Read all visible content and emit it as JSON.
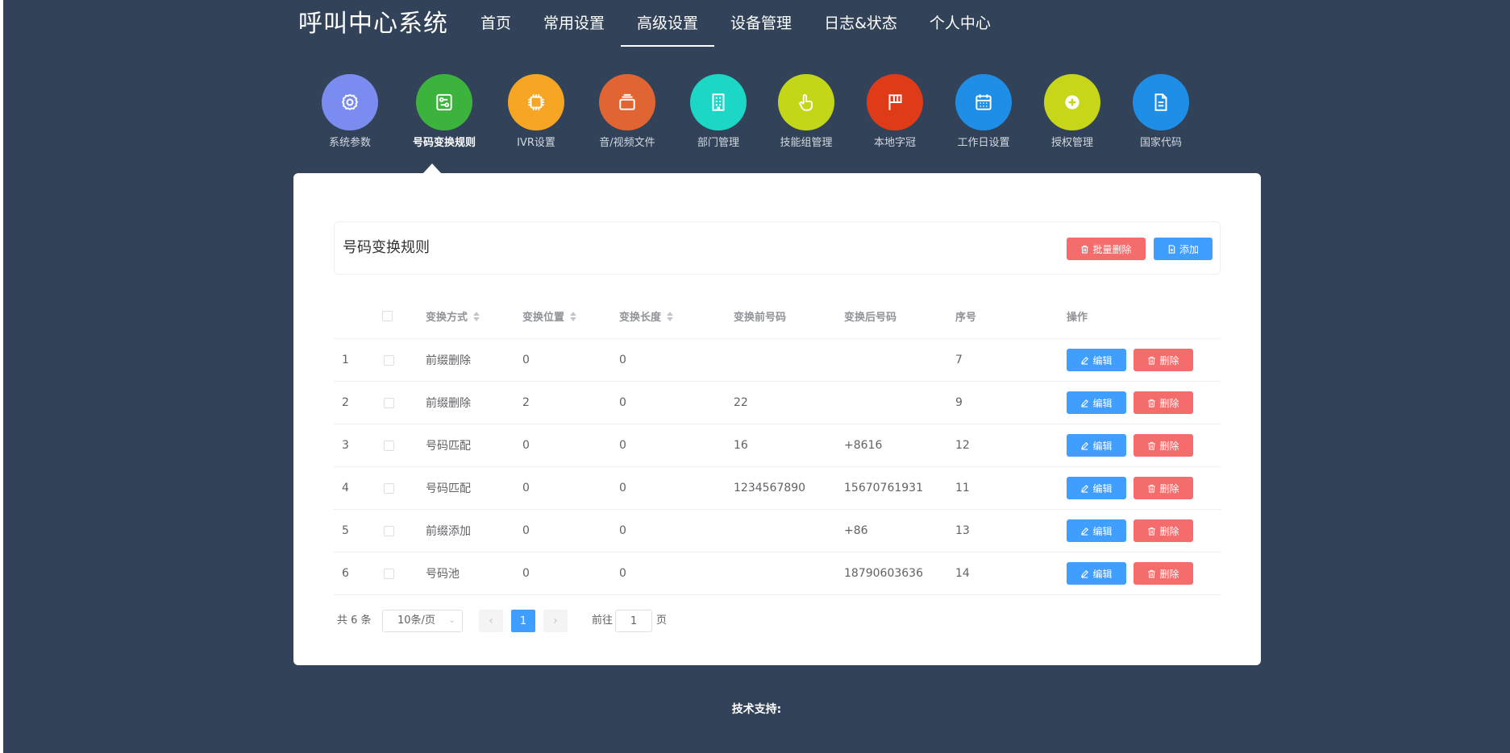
{
  "app": {
    "title": "呼叫中心系统"
  },
  "topnav": [
    {
      "label": "首页",
      "active": false
    },
    {
      "label": "常用设置",
      "active": false
    },
    {
      "label": "高级设置",
      "active": true
    },
    {
      "label": "设备管理",
      "active": false
    },
    {
      "label": "日志&状态",
      "active": false
    },
    {
      "label": "个人中心",
      "active": false
    }
  ],
  "subnav": [
    {
      "label": "系统参数",
      "icon": "gear-icon",
      "color": "#7b8cf0"
    },
    {
      "label": "号码变换规则",
      "icon": "sliders-card-icon",
      "color": "#3cb33c",
      "active": true
    },
    {
      "label": "IVR设置",
      "icon": "chip-icon",
      "color": "#f6a623"
    },
    {
      "label": "音/视频文件",
      "icon": "files-stack-icon",
      "color": "#e06532"
    },
    {
      "label": "部门管理",
      "icon": "building-icon",
      "color": "#1cd6c6"
    },
    {
      "label": "技能组管理",
      "icon": "hand-pointer-icon",
      "color": "#c3d618"
    },
    {
      "label": "本地字冠",
      "icon": "flag-icon",
      "color": "#e03b18"
    },
    {
      "label": "工作日设置",
      "icon": "calendar-icon",
      "color": "#1e8ee6"
    },
    {
      "label": "授权管理",
      "icon": "plus-circle-icon",
      "color": "#c7d618"
    },
    {
      "label": "国家代码",
      "icon": "document-icon",
      "color": "#1e8ee6"
    }
  ],
  "panel": {
    "title": "号码变换规则",
    "batch_delete_label": "批量删除",
    "add_label": "添加"
  },
  "table": {
    "columns": [
      "变换方式",
      "变换位置",
      "变换长度",
      "变换前号码",
      "变换后号码",
      "序号",
      "操作"
    ],
    "edit_label": "编辑",
    "delete_label": "删除",
    "rows": [
      {
        "index": "1",
        "mode": "前缀删除",
        "position": "0",
        "length": "0",
        "before": "",
        "after": "",
        "seq": "7"
      },
      {
        "index": "2",
        "mode": "前缀删除",
        "position": "2",
        "length": "0",
        "before": "22",
        "after": "",
        "seq": "9"
      },
      {
        "index": "3",
        "mode": "号码匹配",
        "position": "0",
        "length": "0",
        "before": "16",
        "after": "+8616",
        "seq": "12"
      },
      {
        "index": "4",
        "mode": "号码匹配",
        "position": "0",
        "length": "0",
        "before": "1234567890",
        "after": "15670761931",
        "seq": "11"
      },
      {
        "index": "5",
        "mode": "前缀添加",
        "position": "0",
        "length": "0",
        "before": "",
        "after": "+86",
        "seq": "13"
      },
      {
        "index": "6",
        "mode": "号码池",
        "position": "0",
        "length": "0",
        "before": "",
        "after": "18790603636",
        "seq": "14"
      }
    ]
  },
  "pagination": {
    "total": "共 6 条",
    "page_size": "10条/页",
    "current_page": "1",
    "goto_prefix": "前往",
    "goto_value": "1",
    "goto_suffix": "页"
  },
  "footer": {
    "text": "技术支持:"
  },
  "colors": {
    "background": "#324359",
    "primary": "#409eff",
    "danger": "#f56c6c"
  }
}
